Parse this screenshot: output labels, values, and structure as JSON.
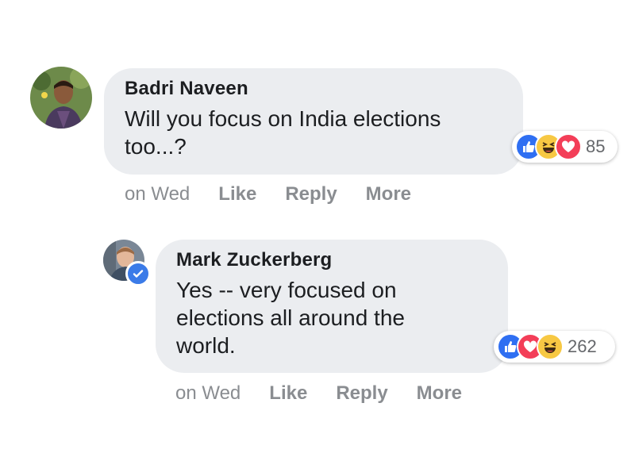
{
  "comments": [
    {
      "author": "Badri Naveen",
      "line1": "Will you focus on India elections",
      "line2": "too...?",
      "reaction_count": "85",
      "reactions": [
        "like-icon",
        "haha-icon",
        "love-icon"
      ],
      "time": "on Wed",
      "actions": {
        "like": "Like",
        "reply": "Reply",
        "more": "More"
      }
    },
    {
      "author": "Mark Zuckerberg",
      "line1": "Yes -- very focused on",
      "line2": "elections all around the",
      "line3": "world.",
      "reaction_count": "262",
      "reactions": [
        "like-icon",
        "love-icon",
        "haha-icon"
      ],
      "verified": true,
      "time": "on Wed",
      "actions": {
        "like": "Like",
        "reply": "Reply",
        "more": "More"
      }
    }
  ],
  "colors": {
    "bubble": "#ebedf0",
    "like": "#2f6ff2",
    "love": "#f33e58",
    "haha": "#f7c843",
    "muted": "#8a8d91"
  }
}
